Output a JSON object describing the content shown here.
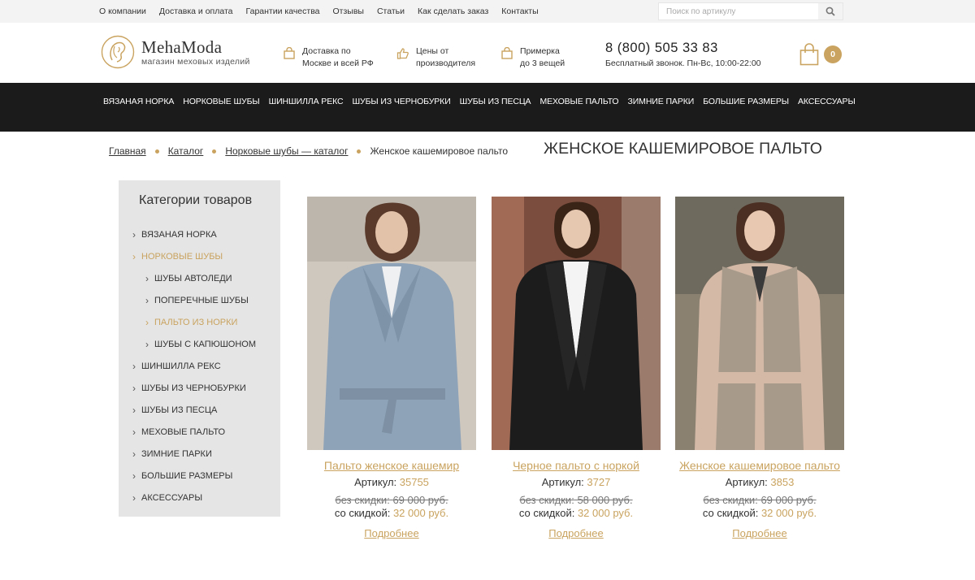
{
  "topbar": {
    "links": [
      "О компании",
      "Доставка и оплата",
      "Гарантии качества",
      "Отзывы",
      "Статьи",
      "Как сделать заказ",
      "Контакты"
    ],
    "search_placeholder": "Поиск по артикулу"
  },
  "header": {
    "brand": "MehaModa",
    "tagline": "магазин меховых изделий",
    "features": [
      {
        "icon": "bag-icon",
        "line1": "Доставка по",
        "line2": "Москве и всей РФ"
      },
      {
        "icon": "thumbs-up-icon",
        "line1": "Цены от",
        "line2": "производителя"
      },
      {
        "icon": "bag-icon",
        "line1": "Примерка",
        "line2": "до 3 вещей"
      }
    ],
    "phone": "8 (800) 505 33 83",
    "phone_note": "Бесплатный звонок. Пн-Вс, 10:00-22:00",
    "cart_count": "0"
  },
  "nav": [
    "ВЯЗАНАЯ НОРКА",
    "НОРКОВЫЕ ШУБЫ",
    "ШИНШИЛЛА РЕКС",
    "ШУБЫ ИЗ ЧЕРНОБУРКИ",
    "ШУБЫ ИЗ ПЕСЦА",
    "МЕХОВЫЕ ПАЛЬТО",
    "ЗИМНИЕ ПАРКИ",
    "БОЛЬШИЕ РАЗМЕРЫ",
    "АКСЕССУАРЫ"
  ],
  "breadcrumb": [
    "Главная",
    "Каталог",
    "Норковые шубы — каталог",
    "Женское кашемировое пальто"
  ],
  "page_title": "ЖЕНСКОЕ КАШЕМИРОВОЕ ПАЛЬТО",
  "sidebar": {
    "title": "Категории товаров",
    "items": [
      {
        "label": "ВЯЗАНАЯ НОРКА"
      },
      {
        "label": "НОРКОВЫЕ ШУБЫ"
      },
      {
        "label": "ШУБЫ АВТОЛЕДИ"
      },
      {
        "label": "ПОПЕРЕЧНЫЕ ШУБЫ"
      },
      {
        "label": "ПАЛЬТО ИЗ НОРКИ"
      },
      {
        "label": "ШУБЫ С КАПЮШОНОМ"
      },
      {
        "label": "ШИНШИЛЛА РЕКС"
      },
      {
        "label": "ШУБЫ ИЗ ЧЕРНОБУРКИ"
      },
      {
        "label": "ШУБЫ ИЗ ПЕСЦА"
      },
      {
        "label": "МЕХОВЫЕ ПАЛЬТО"
      },
      {
        "label": "ЗИМНИЕ ПАРКИ"
      },
      {
        "label": "БОЛЬШИЕ РАЗМЕРЫ"
      },
      {
        "label": "АКСЕССУАРЫ"
      }
    ]
  },
  "products": [
    {
      "name": "Пальто женское кашемир",
      "article_label": "Артикул:",
      "article": "35755",
      "old_label": "без скидки:",
      "old_price": "69 000 руб.",
      "new_label": "со скидкой:",
      "new_price": "32 000 руб.",
      "more": "Подробнее",
      "coat_color": "#8fa3b8",
      "bg_color": "#c9c2b8"
    },
    {
      "name": "Черное пальто с норкой",
      "article_label": "Артикул:",
      "article": "3727",
      "old_label": "без скидки:",
      "old_price": "58 000 руб.",
      "new_label": "со скидкой:",
      "new_price": "32 000 руб.",
      "more": "Подробнее",
      "coat_color": "#1c1c1c",
      "bg_color": "#8a5a4a"
    },
    {
      "name": "Женское кашемировое пальто",
      "article_label": "Артикул:",
      "article": "3853",
      "old_label": "без скидки:",
      "old_price": "69 000 руб.",
      "new_label": "со скидкой:",
      "new_price": "32 000 руб.",
      "more": "Подробнее",
      "coat_color": "#b5a79a",
      "bg_color": "#8a8070"
    }
  ],
  "colors": {
    "accent": "#c9a35f",
    "nav_bg": "#1b1b1b",
    "sidebar_bg": "#e5e5e5"
  }
}
